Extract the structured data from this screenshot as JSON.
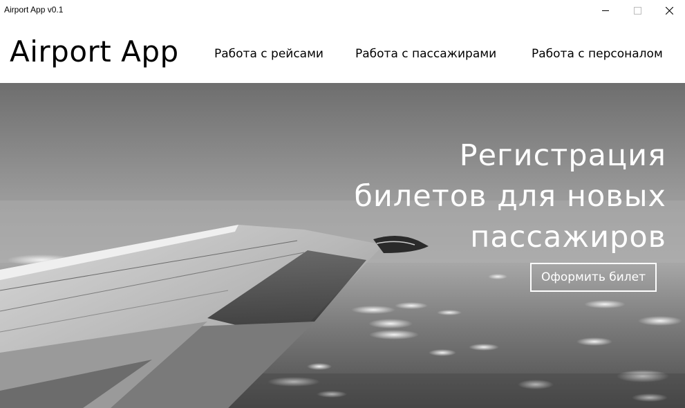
{
  "window": {
    "title": "Airport App v0.1",
    "controls": [
      "minimize-icon",
      "maximize-icon",
      "close-icon"
    ]
  },
  "header": {
    "app_title": "Airport App",
    "nav": [
      {
        "label": "Работа с рейсами"
      },
      {
        "label": "Работа с пассажирами"
      },
      {
        "label": "Работа с персоналом"
      }
    ]
  },
  "hero": {
    "heading_lines": [
      "Регистрация",
      "билетов для новых",
      "пассажиров"
    ],
    "cta_label": "Оформить билет",
    "image": "airplane-wing-over-clouds (grayscale)"
  },
  "colors": {
    "header_bg": "#ffffff",
    "text": "#000000",
    "hero_text": "#ffffff"
  }
}
